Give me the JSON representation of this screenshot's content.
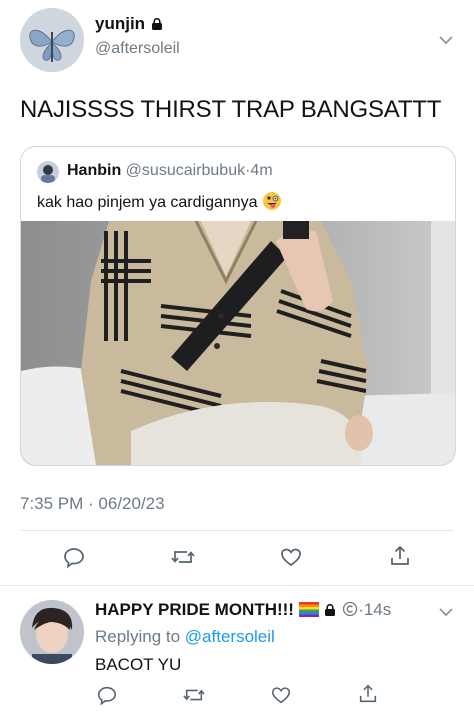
{
  "tweet": {
    "author": {
      "name": "yunjin",
      "handle": "@aftersoleil",
      "avatar_icon": "butterfly-avatar",
      "locked": true
    },
    "text": "NAJISSSS THIRST TRAP BANGSATTT",
    "quote": {
      "author_name": "Hanbin",
      "handle": "@susucairbubuk",
      "time": "4m",
      "separator": "·",
      "text": "kak hao pinjem ya cardigannya",
      "emoji": "zany-face",
      "image_icon": "photo-person-cardigan"
    },
    "timestamp": "7:35 PM · 06/20/23",
    "actions": [
      "reply-icon",
      "retweet-icon",
      "like-icon",
      "share-icon"
    ]
  },
  "reply": {
    "author_name": "HAPPY PRIDE MONTH!!!",
    "badges": [
      "rainbow-flag-icon",
      "lock-icon",
      "copyright-icon"
    ],
    "time": "·14s",
    "replying_prefix": "Replying to",
    "replying_handle": "@aftersoleil",
    "text": "BACOT YU",
    "actions": [
      "reply-icon",
      "retweet-icon",
      "like-icon",
      "share-icon"
    ]
  },
  "colors": {
    "accent": "#1d9bf0",
    "muted": "#6e7b86",
    "divider": "#e3e6ea"
  }
}
